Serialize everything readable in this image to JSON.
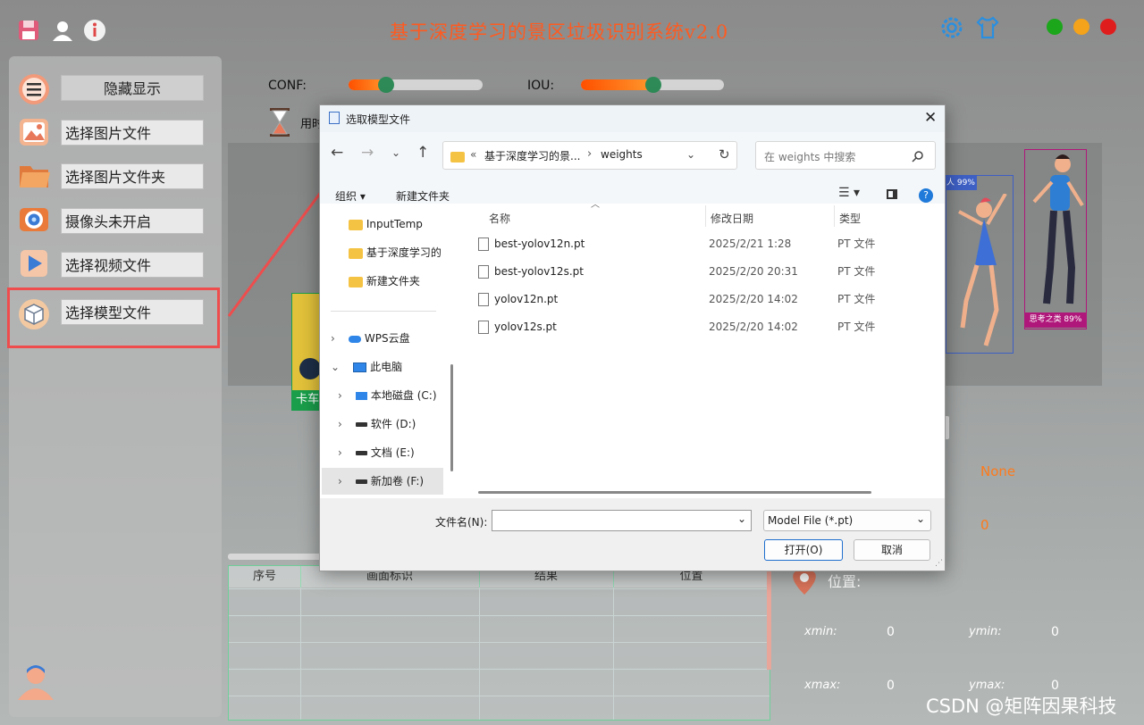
{
  "app": {
    "title": "基于深度学习的景区垃圾识别系统v2.0",
    "colors": {
      "title": "#ff5a1f",
      "accent": "#2e8b57",
      "highlight": "#ef4d4d"
    },
    "window_buttons": [
      {
        "name": "maximize",
        "color": "#1ba61b"
      },
      {
        "name": "minimize",
        "color": "#f4a31a"
      },
      {
        "name": "close",
        "color": "#e01d1d"
      }
    ]
  },
  "sidebar": {
    "items": [
      {
        "label": "隐藏显示",
        "icon": "menu-icon"
      },
      {
        "label": "选择图片文件",
        "icon": "image-icon"
      },
      {
        "label": "选择图片文件夹",
        "icon": "folder-icon"
      },
      {
        "label": "摄像头未开启",
        "icon": "camera-icon"
      },
      {
        "label": "选择视频文件",
        "icon": "video-icon"
      },
      {
        "label": "选择模型文件",
        "icon": "model-box-icon"
      }
    ]
  },
  "controls": {
    "conf_label": "CONF:",
    "conf_value": 0.28,
    "iou_label": "IOU:",
    "iou_value": 0.5,
    "time_label": "用时"
  },
  "detections_overlay": {
    "box1_label": "人 99%",
    "box2_label": "思考之类 89%",
    "box3_label": "卡车"
  },
  "table": {
    "headers": [
      "序号",
      "画面标识",
      "结果",
      "位置"
    ]
  },
  "info": {
    "result_value": "None",
    "count_value": "0",
    "position_label": "位置:",
    "xmin_label": "xmin:",
    "xmin_value": "0",
    "ymin_label": "ymin:",
    "ymin_value": "0",
    "xmax_label": "xmax:",
    "xmax_value": "0",
    "ymax_label": "ymax:",
    "ymax_value": "0"
  },
  "dialog": {
    "title": "选取模型文件",
    "address": {
      "prefix": "«",
      "part1": "基于深度学习的景...",
      "sep": "›",
      "part2": "weights"
    },
    "search_placeholder": "在 weights 中搜索",
    "toolbar": {
      "organize": "组织 ▾",
      "new_folder": "新建文件夹"
    },
    "nav": {
      "folders": [
        "InputTemp",
        "基于深度学习的",
        "新建文件夹"
      ],
      "cloud": "WPS云盘",
      "pc": "此电脑",
      "drives": [
        "本地磁盘 (C:)",
        "软件 (D:)",
        "文档 (E:)",
        "新加卷 (F:)"
      ]
    },
    "columns": {
      "name": "名称",
      "date": "修改日期",
      "type": "类型"
    },
    "files": [
      {
        "name": "best-yolov12n.pt",
        "date": "2025/2/21 1:28",
        "type": "PT 文件"
      },
      {
        "name": "best-yolov12s.pt",
        "date": "2025/2/20 20:31",
        "type": "PT 文件"
      },
      {
        "name": "yolov12n.pt",
        "date": "2025/2/20 14:02",
        "type": "PT 文件"
      },
      {
        "name": "yolov12s.pt",
        "date": "2025/2/20 14:02",
        "type": "PT 文件"
      }
    ],
    "filename_label": "文件名(N):",
    "filename_value": "",
    "filter": "Model File (*.pt)",
    "open_button": "打开(O)",
    "cancel_button": "取消"
  },
  "watermark": "CSDN @矩阵因果科技"
}
